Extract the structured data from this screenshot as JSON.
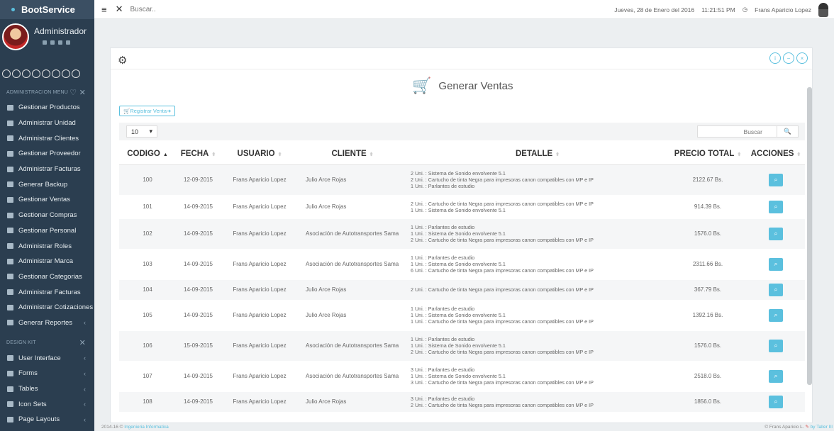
{
  "app": {
    "brand": "BootService"
  },
  "profile": {
    "role": "Administrador"
  },
  "topbar": {
    "search_placeholder": "Buscar..",
    "date": "Jueves, 28 de Enero del 2016",
    "time": "11:21:51 PM",
    "user": "Frans Aparicio Lopez"
  },
  "sidebar": {
    "admin_header": "ADMINISTRACION MENU",
    "items": [
      {
        "label": "Gestionar Productos"
      },
      {
        "label": "Administrar Unidad"
      },
      {
        "label": "Administrar Clientes"
      },
      {
        "label": "Gestionar Proveedor"
      },
      {
        "label": "Administrar Facturas"
      },
      {
        "label": "Generar Backup"
      },
      {
        "label": "Gestionar Ventas"
      },
      {
        "label": "Gestionar Compras"
      },
      {
        "label": "Gestionar Personal"
      },
      {
        "label": "Administrar Roles"
      },
      {
        "label": "Administrar Marca"
      },
      {
        "label": "Gestionar Categorias"
      },
      {
        "label": "Administrar Facturas"
      },
      {
        "label": "Administrar Cotizaciones"
      },
      {
        "label": "Generar Reportes"
      }
    ],
    "design_header": "DESIGN KIT",
    "design_items": [
      {
        "label": "User Interface"
      },
      {
        "label": "Forms"
      },
      {
        "label": "Tables"
      },
      {
        "label": "Icon Sets"
      },
      {
        "label": "Page Layouts"
      }
    ]
  },
  "panel": {
    "title": "Generar Ventas",
    "register_button": "Registrar Venta",
    "page_length": "10",
    "search_placeholder": "Buscar",
    "columns": [
      "CODIGO",
      "FECHA",
      "USUARIO",
      "CLIENTE",
      "DETALLE",
      "PRECIO TOTAL",
      "ACCIONES"
    ]
  },
  "rows": [
    {
      "codigo": "100",
      "fecha": "12-09-2015",
      "usuario": "Frans Aparicio Lopez",
      "cliente": "Julio Arce Rojas",
      "detalle": [
        "2 Uni. : Sistema de Sonido envolvente 5.1",
        "2 Uni. : Cartucho de tinta Negra para impresoras canon compatibles con MP e IP",
        "1 Uni. : Parlantes de estudio"
      ],
      "precio": "2122.67 Bs."
    },
    {
      "codigo": "101",
      "fecha": "14-09-2015",
      "usuario": "Frans Aparicio Lopez",
      "cliente": "Julio Arce Rojas",
      "detalle": [
        "2 Uni. : Cartucho de tinta Negra para impresoras canon compatibles con MP e IP",
        "1 Uni. : Sistema de Sonido envolvente 5.1"
      ],
      "precio": "914.39 Bs."
    },
    {
      "codigo": "102",
      "fecha": "14-09-2015",
      "usuario": "Frans Aparicio Lopez",
      "cliente": "Asociación de Autotransportes Sama",
      "detalle": [
        "1 Uni. : Parlantes de estudio",
        "1 Uni. : Sistema de Sonido envolvente 5.1",
        "2 Uni. : Cartucho de tinta Negra para impresoras canon compatibles con MP e IP"
      ],
      "precio": "1576.0 Bs."
    },
    {
      "codigo": "103",
      "fecha": "14-09-2015",
      "usuario": "Frans Aparicio Lopez",
      "cliente": "Asociación de Autotransportes Sama",
      "detalle": [
        "1 Uni. : Parlantes de estudio",
        "1 Uni. : Sistema de Sonido envolvente 5.1",
        "6 Uni. : Cartucho de tinta Negra para impresoras canon compatibles con MP e IP"
      ],
      "precio": "2311.66 Bs."
    },
    {
      "codigo": "104",
      "fecha": "14-09-2015",
      "usuario": "Frans Aparicio Lopez",
      "cliente": "Julio Arce Rojas",
      "detalle": [
        "2 Uni. : Cartucho de tinta Negra para impresoras canon compatibles con MP e IP"
      ],
      "precio": "367.79 Bs."
    },
    {
      "codigo": "105",
      "fecha": "14-09-2015",
      "usuario": "Frans Aparicio Lopez",
      "cliente": "Julio Arce Rojas",
      "detalle": [
        "1 Uni. : Parlantes de estudio",
        "1 Uni. : Sistema de Sonido envolvente 5.1",
        "1 Uni. : Cartucho de tinta Negra para impresoras canon compatibles con MP e IP"
      ],
      "precio": "1392.16 Bs."
    },
    {
      "codigo": "106",
      "fecha": "15-09-2015",
      "usuario": "Frans Aparicio Lopez",
      "cliente": "Asociación de Autotransportes Sama",
      "detalle": [
        "1 Uni. : Parlantes de estudio",
        "1 Uni. : Sistema de Sonido envolvente 5.1",
        "2 Uni. : Cartucho de tinta Negra para impresoras canon compatibles con MP e IP"
      ],
      "precio": "1576.0 Bs."
    },
    {
      "codigo": "107",
      "fecha": "14-09-2015",
      "usuario": "Frans Aparicio Lopez",
      "cliente": "Asociación de Autotransportes Sama",
      "detalle": [
        "3 Uni. : Parlantes de estudio",
        "1 Uni. : Sistema de Sonido envolvente 5.1",
        "3 Uni. : Cartucho de tinta Negra para impresoras canon compatibles con MP e IP"
      ],
      "precio": "2518.0 Bs."
    },
    {
      "codigo": "108",
      "fecha": "14-09-2015",
      "usuario": "Frans Aparicio Lopez",
      "cliente": "Julio Arce Rojas",
      "detalle": [
        "3 Uni. : Parlantes de estudio",
        "2 Uni. : Cartucho de tinta Negra para impresoras canon compatibles con MP e IP"
      ],
      "precio": "1856.0 Bs."
    }
  ],
  "footer": {
    "left_prefix": "2014-16 © ",
    "left_link": "Ingenieria Informatica",
    "right_prefix": "© Frans Aparicio L.",
    "right_link": "by Taller III"
  },
  "colors": {
    "accent": "#5bc0de",
    "sidebar": "#2b3e50"
  }
}
